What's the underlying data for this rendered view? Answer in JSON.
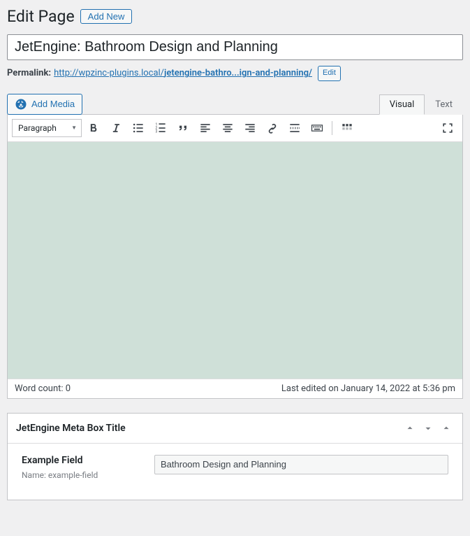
{
  "header": {
    "heading": "Edit Page",
    "add_new": "Add New"
  },
  "title": "JetEngine: Bathroom Design and Planning",
  "permalink": {
    "label": "Permalink:",
    "base": "http://wpzinc-plugins.local/",
    "slug": "jetengine-bathro...ign-and-planning/",
    "edit": "Edit"
  },
  "media_button": "Add Media",
  "tabs": {
    "visual": "Visual",
    "text": "Text"
  },
  "toolbar": {
    "format": "Paragraph"
  },
  "status": {
    "word_count_label": "Word count:",
    "word_count": "0",
    "last_edited": "Last edited on January 14, 2022 at 5:36 pm"
  },
  "metabox": {
    "title": "JetEngine Meta Box Title",
    "field_label": "Example Field",
    "field_name": "Name: example-field",
    "field_value": "Bathroom Design and Planning"
  }
}
